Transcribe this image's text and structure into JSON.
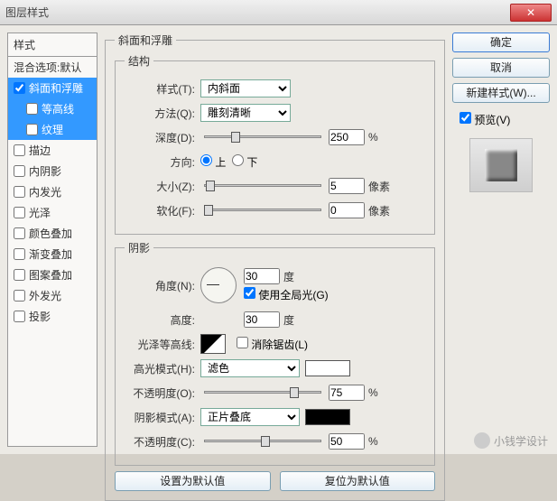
{
  "window": {
    "title": "图层样式"
  },
  "left": {
    "header": "样式",
    "blend": "混合选项:默认",
    "items": [
      {
        "label": "斜面和浮雕",
        "checked": true,
        "sel": true
      },
      {
        "label": "等高线",
        "checked": false,
        "sel": true,
        "indent": true
      },
      {
        "label": "纹理",
        "checked": false,
        "sel": true,
        "indent": true
      },
      {
        "label": "描边",
        "checked": false
      },
      {
        "label": "内阴影",
        "checked": false
      },
      {
        "label": "内发光",
        "checked": false
      },
      {
        "label": "光泽",
        "checked": false
      },
      {
        "label": "颜色叠加",
        "checked": false
      },
      {
        "label": "渐变叠加",
        "checked": false
      },
      {
        "label": "图案叠加",
        "checked": false
      },
      {
        "label": "外发光",
        "checked": false
      },
      {
        "label": "投影",
        "checked": false
      }
    ]
  },
  "panel_title": "斜面和浮雕",
  "struct": {
    "legend": "结构",
    "style_lbl": "样式(T):",
    "style_val": "内斜面",
    "method_lbl": "方法(Q):",
    "method_val": "雕刻清晰",
    "depth_lbl": "深度(D):",
    "depth_val": "250",
    "depth_unit": "%",
    "dir_lbl": "方向:",
    "dir_up": "上",
    "dir_down": "下",
    "size_lbl": "大小(Z):",
    "size_val": "5",
    "size_unit": "像素",
    "soft_lbl": "软化(F):",
    "soft_val": "0",
    "soft_unit": "像素"
  },
  "shadow": {
    "legend": "阴影",
    "angle_lbl": "角度(N):",
    "angle_val": "30",
    "angle_unit": "度",
    "global": "使用全局光(G)",
    "alt_lbl": "高度:",
    "alt_val": "30",
    "alt_unit": "度",
    "gloss_lbl": "光泽等高线:",
    "aa": "消除锯齿(L)",
    "hi_mode_lbl": "高光模式(H):",
    "hi_mode_val": "滤色",
    "hi_color": "#ffffff",
    "hi_op_lbl": "不透明度(O):",
    "hi_op_val": "75",
    "hi_op_unit": "%",
    "sh_mode_lbl": "阴影模式(A):",
    "sh_mode_val": "正片叠底",
    "sh_color": "#000000",
    "sh_op_lbl": "不透明度(C):",
    "sh_op_val": "50",
    "sh_op_unit": "%"
  },
  "buttons": {
    "default": "设置为默认值",
    "reset": "复位为默认值"
  },
  "right": {
    "ok": "确定",
    "cancel": "取消",
    "new": "新建样式(W)...",
    "preview": "预览(V)"
  },
  "watermark": "小钱学设计"
}
